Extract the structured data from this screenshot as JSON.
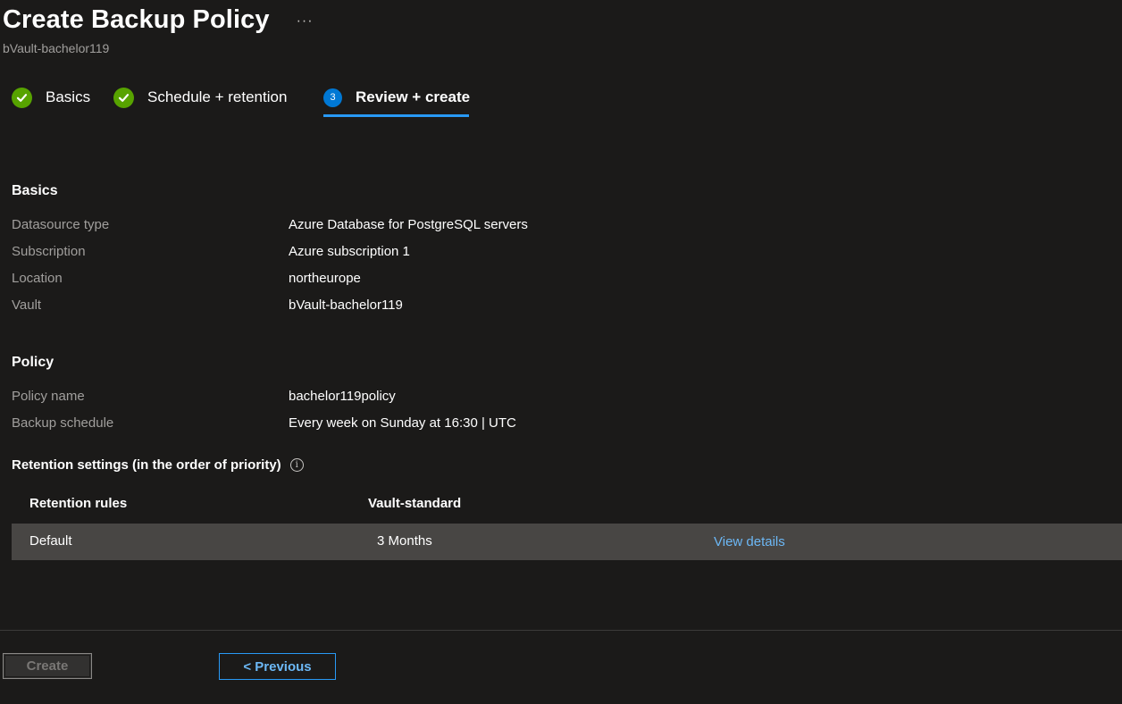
{
  "header": {
    "title": "Create Backup Policy",
    "more_label": "···",
    "subtitle": "bVault-bachelor119"
  },
  "steps": [
    {
      "label": "Basics",
      "status": "complete",
      "icon": "check-circle-icon"
    },
    {
      "label": "Schedule + retention",
      "status": "complete",
      "icon": "check-circle-icon"
    },
    {
      "label": "Review + create",
      "status": "active",
      "number": "3"
    }
  ],
  "basics": {
    "heading": "Basics",
    "rows": [
      {
        "key": "Datasource type",
        "value": "Azure Database for PostgreSQL servers"
      },
      {
        "key": "Subscription",
        "value": "Azure subscription 1"
      },
      {
        "key": "Location",
        "value": "northeurope"
      },
      {
        "key": "Vault",
        "value": "bVault-bachelor119"
      }
    ]
  },
  "policy": {
    "heading": "Policy",
    "rows": [
      {
        "key": "Policy name",
        "value": "bachelor119policy"
      },
      {
        "key": "Backup schedule",
        "value": "Every week on Sunday at 16:30 | UTC"
      }
    ]
  },
  "retention": {
    "heading": "Retention settings (in the order of priority)",
    "info_icon": "info-icon",
    "columns": [
      "Retention rules",
      "Vault-standard"
    ],
    "rows": [
      {
        "rule": "Default",
        "vault_standard": "3 Months",
        "action": "View details"
      }
    ]
  },
  "footer": {
    "create_label": "Create",
    "previous_label": "< Previous"
  },
  "colors": {
    "background": "#1b1a19",
    "success": "#57a300",
    "accent": "#0078d4",
    "link": "#6cb8f6",
    "row_highlight": "#484644"
  }
}
